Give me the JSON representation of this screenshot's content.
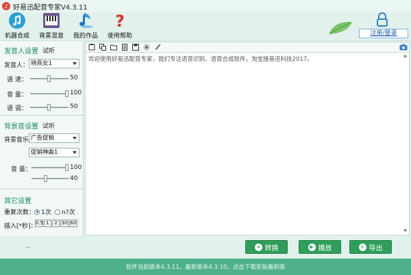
{
  "window": {
    "title": "好易迅配音专家V4.3.11",
    "icon": "app-logo-icon"
  },
  "toolbar": {
    "buttons": [
      {
        "label": "机器合成",
        "icon": "music-note-icon"
      },
      {
        "label": "背景混音",
        "icon": "piano-icon"
      },
      {
        "label": "我的作品",
        "icon": "music-works-icon"
      },
      {
        "label": "使用帮助",
        "icon": "question-mark-icon"
      }
    ],
    "login_link": "注册/登录"
  },
  "speaker": {
    "heading": "发音人设置",
    "trial": "试听",
    "speaker_label": "发音人：",
    "speaker_value": "晓燕女1",
    "speed_label": "语  速：",
    "speed_value": "50",
    "volume_label": "音  量：",
    "volume_value": "100",
    "pitch_label": "语  调：",
    "pitch_value": "50"
  },
  "background": {
    "heading": "背景音设置",
    "trial": "试听",
    "music_label": "背景音乐",
    "music_category": "广告促销",
    "music_track": "促销神曲1",
    "volume_label": "音  量：",
    "volume_value": "100",
    "volume2_value": "40"
  },
  "other": {
    "heading": "其它设置",
    "repeat_label": "重复次数：",
    "repeat_once": "1次",
    "repeat_n": "n?次",
    "insert_label": "插入[*秒]：",
    "insert_buttons": [
      "0.5",
      "1",
      "2",
      "30",
      "60"
    ]
  },
  "editor": {
    "text": "欢迎使用好易迅配音专家，我们专注语音识别、语音合成软件，淘宝搜易迅科技2017。",
    "toolbar_icons": [
      "paste-icon",
      "copy-icon",
      "open-file-icon",
      "document-icon",
      "save-icon",
      "sparkle-icon",
      "clear-brush-icon"
    ],
    "camera_icon": "camera-icon"
  },
  "status": {
    "dots": "..."
  },
  "actions": {
    "convert": "转换",
    "play": "播放",
    "export": "导出"
  },
  "footer": {
    "text": "软件当前版本4.3.11，最新版本4.3.10，点击下载安装最新版"
  },
  "colors": {
    "accent": "#2f9e5b",
    "footer": "#4fb08c",
    "heading": "#1b8a6a"
  }
}
